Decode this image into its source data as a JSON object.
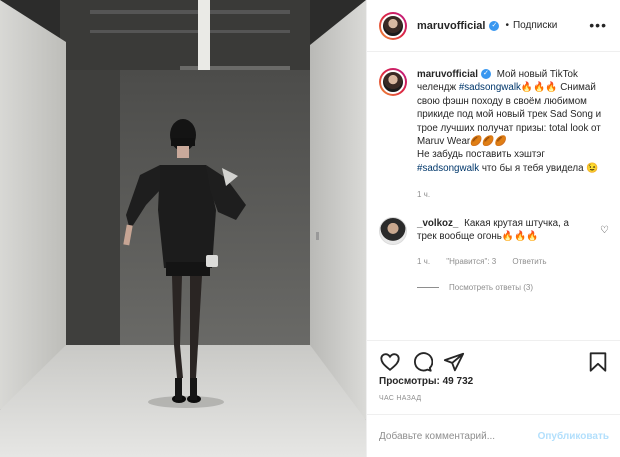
{
  "post": {
    "username": "maruvofficial",
    "verified_mark": "✓",
    "dot": "•",
    "follow_status": "Подписки",
    "more_icon": "•••"
  },
  "caption": {
    "username": "maruvofficial",
    "verified_mark": "✓",
    "text_1": "Мой новый TikTok челендж",
    "hashtag_1": "#sadsongwalk",
    "text_2": "🔥🔥🔥 Снимай свою фэшн походу в своём любимом прикиде под мой новый трек Sad Song и трое лучших получат призы: total look от Maruv Wear🏉🏉🏉",
    "text_3": "Не забудь поставить хэштэг",
    "hashtag_2": "#sadsongwalk",
    "text_4": "что бы я тебя увидела 😉",
    "time": "1 ч."
  },
  "comment": {
    "username": "_volkoz_",
    "text": "Какая крутая штучка, а трек вообще огонь🔥🔥🔥",
    "time": "1 ч.",
    "likes_label": "\"Нравится\": 3",
    "reply_label": "Ответить",
    "view_replies": "Посмотреть ответы (3)"
  },
  "stats": {
    "views": "Просмотры: 49 732",
    "posted": "ЧАС НАЗАД"
  },
  "add_comment": {
    "placeholder": "Добавьте комментарий...",
    "publish": "Опубликовать"
  },
  "icons": {
    "header_avatar": "avatar",
    "like": "heart-icon",
    "comment": "comment-icon",
    "share": "share-icon",
    "save": "bookmark-icon"
  },
  "colors": {
    "verified": "#3897f0",
    "hashtag": "#00376b",
    "muted": "#8e8e8e",
    "publish_disabled": "#b2dffc"
  }
}
